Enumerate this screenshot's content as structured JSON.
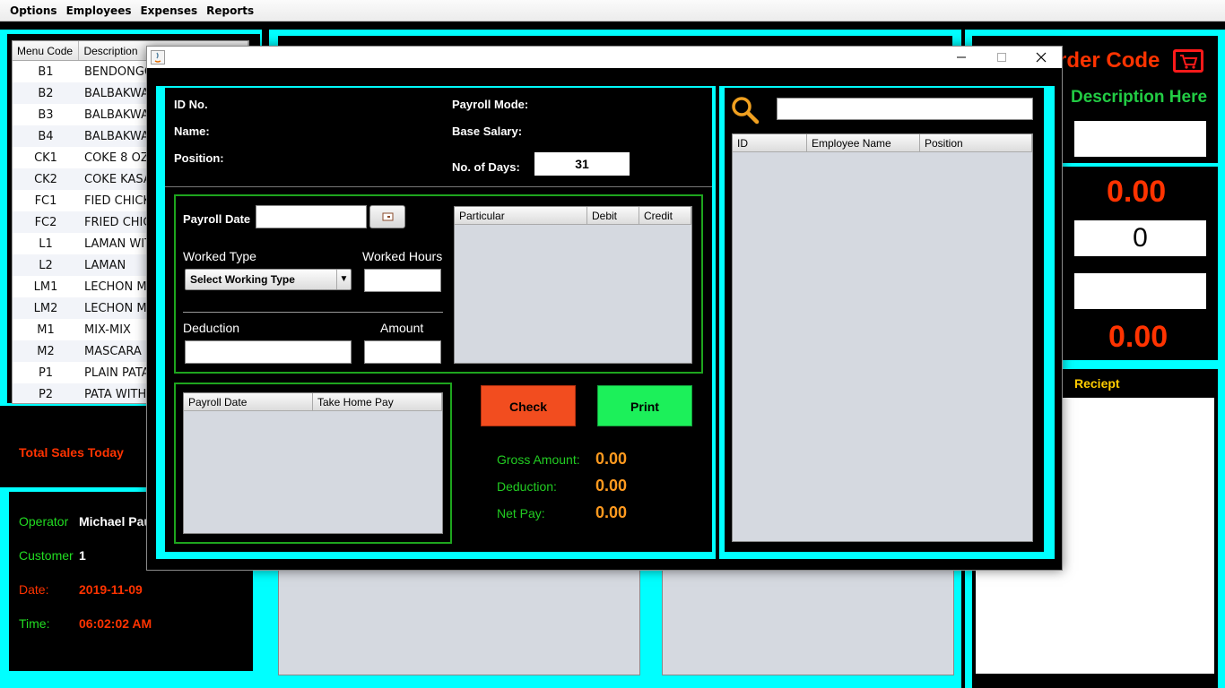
{
  "menubar": [
    "Options",
    "Employees",
    "Expenses",
    "Reports"
  ],
  "menu_table": {
    "headers": [
      "Menu Code",
      "Description"
    ],
    "rows": [
      [
        "B1",
        "BENDONGO"
      ],
      [
        "B2",
        "BALBAKWA"
      ],
      [
        "B3",
        "BALBAKWA"
      ],
      [
        "B4",
        "BALBAKWA"
      ],
      [
        "CK1",
        "COKE 8 OZ"
      ],
      [
        "CK2",
        "COKE  KASA"
      ],
      [
        "FC1",
        "FIED CHICK"
      ],
      [
        "FC2",
        "FRIED CHIC"
      ],
      [
        "L1",
        "LAMAN WIT"
      ],
      [
        "L2",
        "LAMAN"
      ],
      [
        "LM1",
        "LECHON MA"
      ],
      [
        "LM2",
        "LECHON MA"
      ],
      [
        "M1",
        "MIX-MIX"
      ],
      [
        "M2",
        "MASCARA"
      ],
      [
        "P1",
        "PLAIN PATA"
      ],
      [
        "P2",
        "PATA WITH"
      ]
    ]
  },
  "sales": {
    "label": "Total Sales Today"
  },
  "info": {
    "operator_label": "Operator",
    "operator_value": "Michael Pau",
    "customer_label": "Customer",
    "customer_value": "1",
    "date_label": "Date:",
    "date_value": "2019-11-09",
    "time_label": "Time:",
    "time_value": "06:02:02 AM"
  },
  "right_panel": {
    "order_code": "rder Code",
    "description": "Description Here",
    "amount1": "0.00",
    "qty": "0",
    "amount2": "0.00",
    "reciept": "Reciept"
  },
  "dialog": {
    "title": "",
    "id_label": "ID No.",
    "name_label": "Name:",
    "position_label": "Position:",
    "payroll_mode_label": "Payroll Mode:",
    "base_salary_label": "Base Salary:",
    "days_label": "No. of Days:",
    "days_value": "31",
    "payroll_date_label": "Payroll Date",
    "worked_type_label": "Worked Type",
    "worked_type_value": "Select Working Type",
    "worked_hours_label": "Worked Hours",
    "deduction_label": "Deduction",
    "amount_label": "Amount",
    "particular_headers": [
      "Particular",
      "Debit",
      "Credit"
    ],
    "history_headers": [
      "Payroll Date",
      "Take Home Pay"
    ],
    "check_label": "Check",
    "print_label": "Print",
    "gross_label": "Gross Amount:",
    "gross_value": "0.00",
    "deduction_sum_label": "Deduction:",
    "deduction_sum_value": "0.00",
    "net_label": "Net Pay:",
    "net_value": "0.00",
    "employee_headers": [
      "ID",
      "Employee Name",
      "Position"
    ]
  },
  "colors": {
    "cyan": "#00ffff",
    "red": "#ff3300",
    "green": "#22dd22",
    "orange": "#ff9a1f"
  }
}
